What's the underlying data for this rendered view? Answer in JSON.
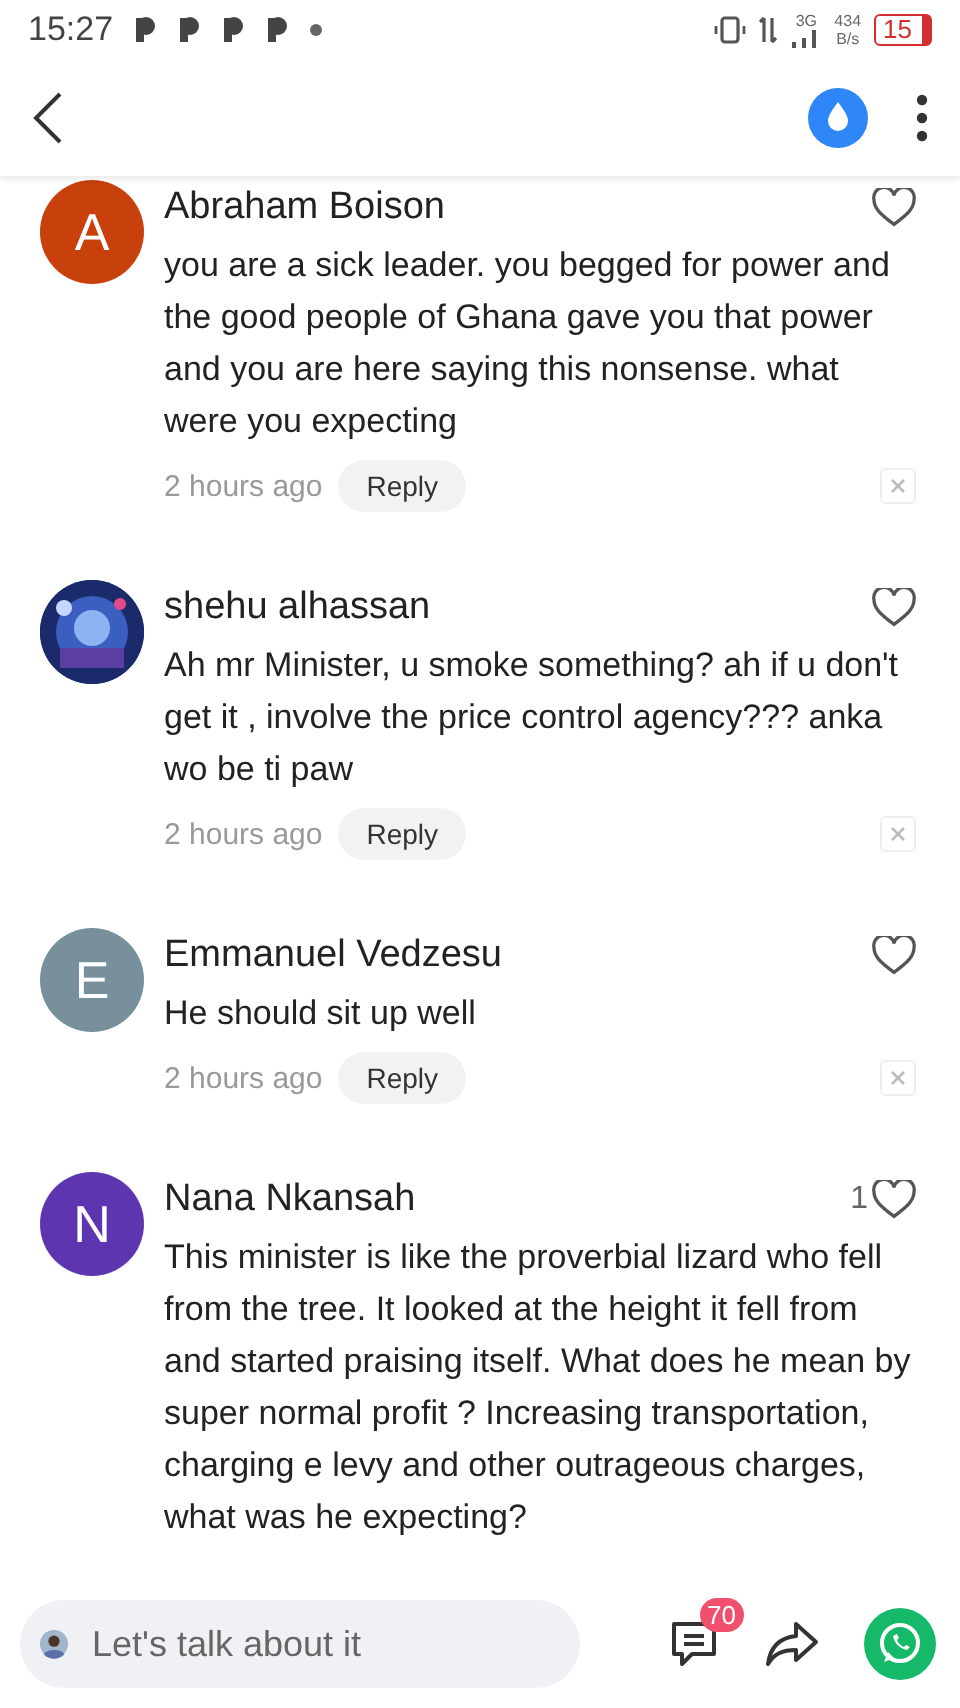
{
  "status_bar": {
    "time": "15:27",
    "network": "3G",
    "speed_value": "434",
    "speed_unit": "B/s",
    "battery": "15"
  },
  "comments": [
    {
      "author": "Abraham Boison",
      "avatar": {
        "kind": "letter",
        "letter": "A",
        "color": "#c8410c"
      },
      "text": "you are a sick leader. you begged for power and the good people of Ghana gave you that power and you are here saying this nonsense. what were you expecting",
      "time": "2 hours ago",
      "reply": "Reply"
    },
    {
      "author": "shehu alhassan",
      "text": "Ah mr Minister, u smoke something?  ah if u don't get it , involve the price control agency??? anka wo be ti paw",
      "time": "2 hours ago",
      "reply": "Reply"
    },
    {
      "author": "Emmanuel Vedzesu",
      "avatar": {
        "kind": "letter",
        "letter": "E",
        "color": "#78909c"
      },
      "text": "He should sit up well",
      "time": "2 hours ago",
      "reply": "Reply"
    },
    {
      "author": "Nana Nkansah",
      "avatar": {
        "kind": "letter",
        "letter": "N",
        "color": "#5e35b1"
      },
      "likes": "1",
      "text": "This minister is like the proverbial lizard who fell from the tree. It looked at the height it fell from and started praising itself.  What does he mean by super normal profit ? Increasing transportation, charging e levy and other outrageous charges, what was he expecting?"
    }
  ],
  "composer": {
    "placeholder": "Let's talk about it",
    "comment_count": "70"
  }
}
